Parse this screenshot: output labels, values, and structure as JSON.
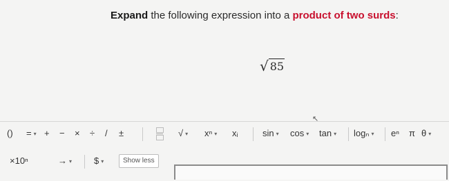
{
  "question": {
    "bold_part": "Expand",
    "middle_part": " the following expression into a ",
    "red_part": "product of two surds",
    "end_part": ":"
  },
  "expression": {
    "radical_sign": "√",
    "radicand": "85"
  },
  "toolbar": {
    "row1": {
      "parens": "()",
      "equals": "=",
      "plus": "+",
      "minus": "−",
      "times": "×",
      "divide": "÷",
      "slash": "/",
      "plusminus": "±",
      "sqrt": "√",
      "power": "xⁿ",
      "subscript": "xᵢ",
      "sin": "sin",
      "cos": "cos",
      "tan": "tan",
      "log": "logₙ",
      "exp": "eⁿ",
      "pi": "π",
      "theta": "θ"
    },
    "row2": {
      "sci": "×10ⁿ",
      "arrow": "→",
      "currency": "$",
      "show_less": "Show less"
    }
  },
  "colors": {
    "accent_red": "#c8102e"
  }
}
